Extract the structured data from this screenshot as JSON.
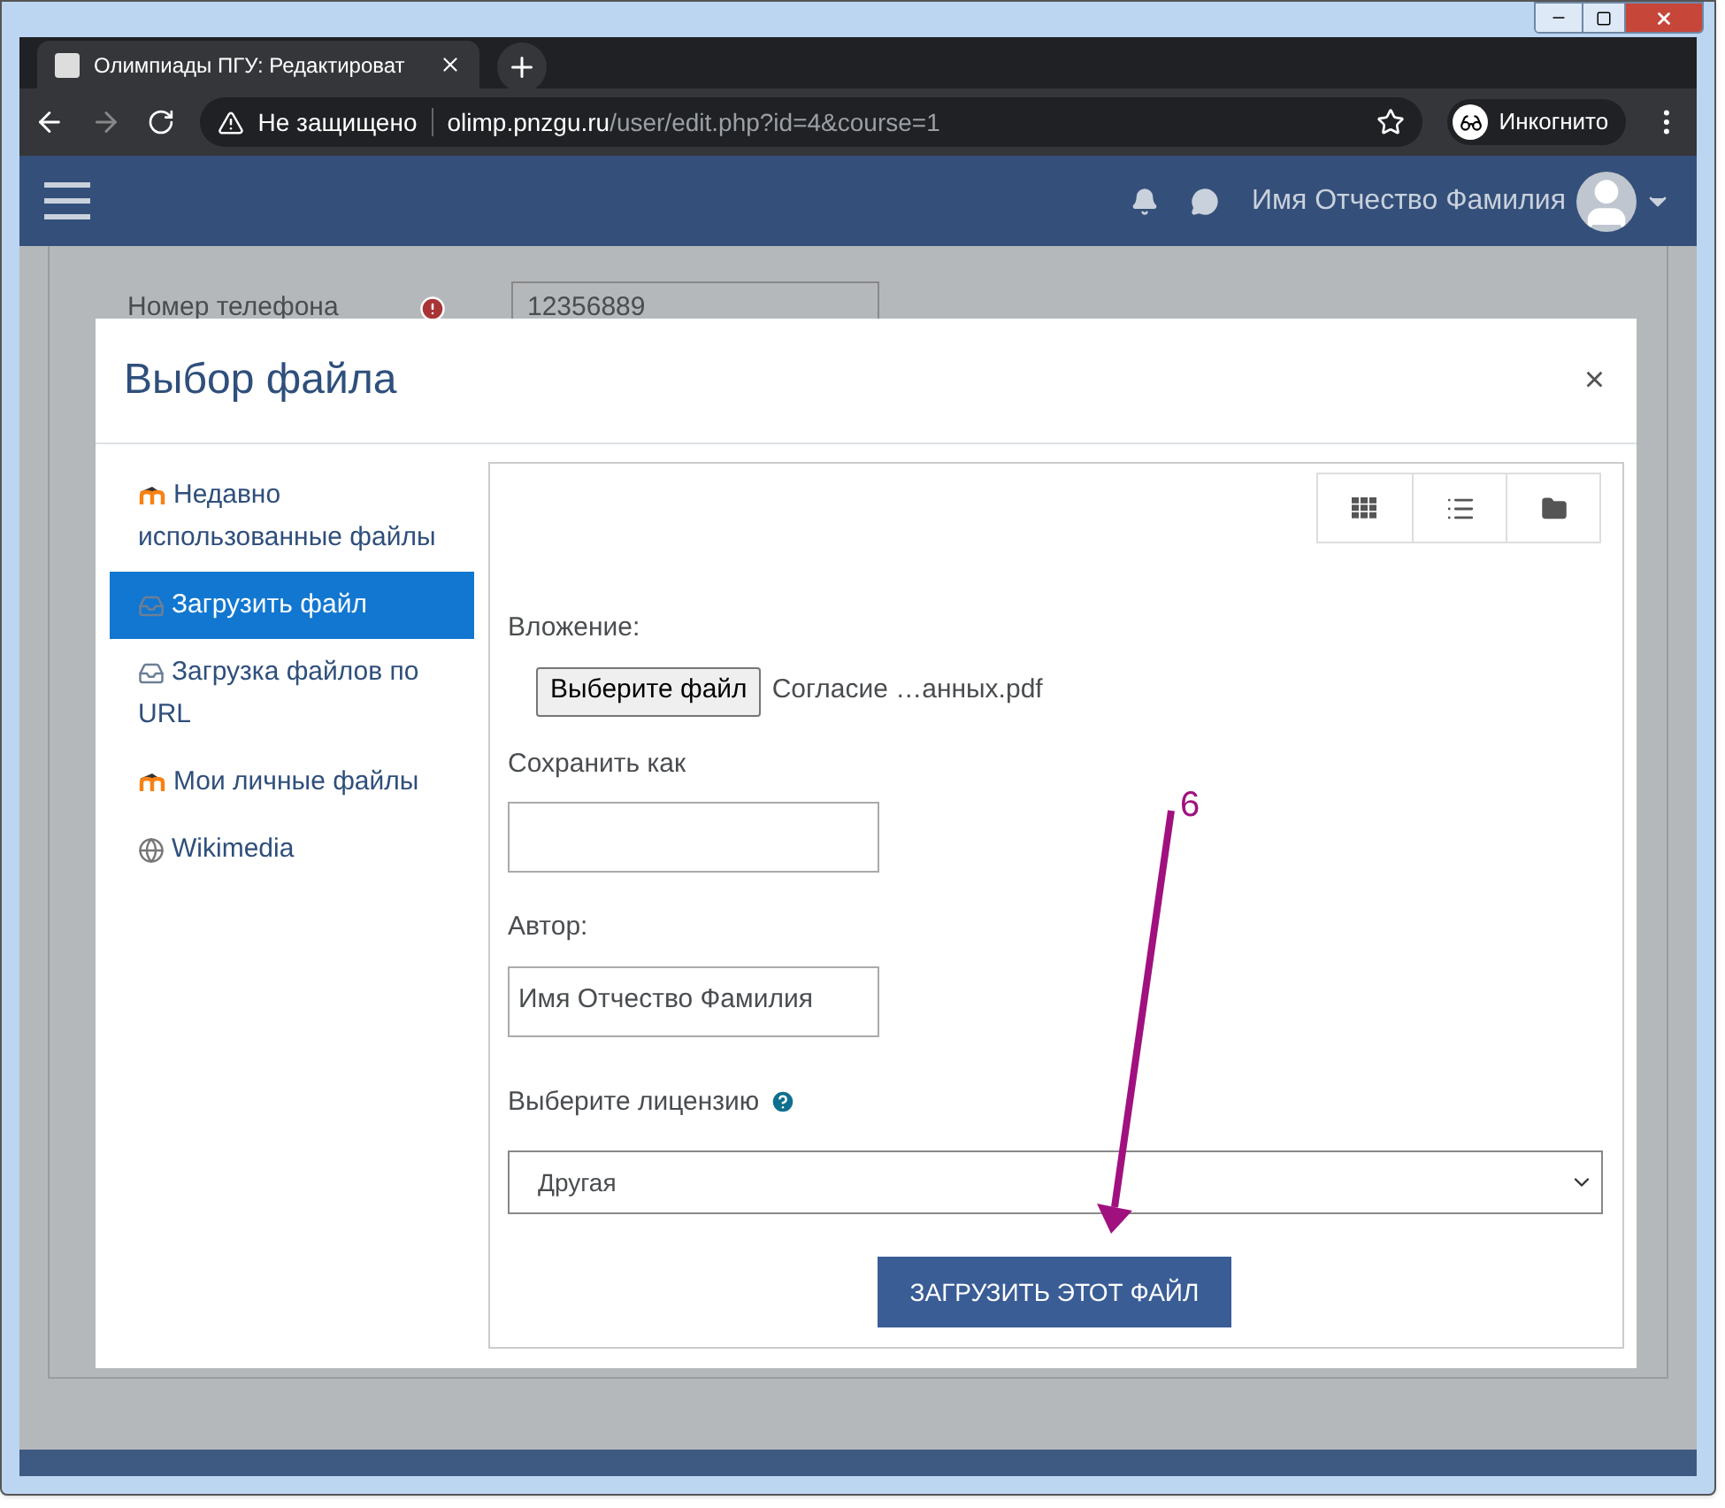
{
  "browser": {
    "tab_title": "Олимпиады ПГУ: Редактироват",
    "security": "Не защищено",
    "url_host": "olimp.pnzgu.ru",
    "url_path": "/user/edit.php?id=4&course=1",
    "incognito": "Инкогнито"
  },
  "navbar": {
    "user_name": "Имя Отчество Фамилия"
  },
  "page": {
    "phone_label": "Номер телефона",
    "phone_value": "12356889"
  },
  "dialog": {
    "title": "Выбор файла",
    "close": "×",
    "repositories": [
      {
        "kind": "moodle",
        "label": "Недавно использованные файлы",
        "selected": false
      },
      {
        "kind": "upload",
        "label": "Загрузить файл",
        "selected": true
      },
      {
        "kind": "upload",
        "label": "Загрузка файлов по URL",
        "selected": false
      },
      {
        "kind": "moodle",
        "label": "Мои личные файлы",
        "selected": false
      },
      {
        "kind": "wiki",
        "label": "Wikimedia",
        "selected": false
      }
    ],
    "view_buttons": [
      {
        "kind": "icons"
      },
      {
        "kind": "list"
      },
      {
        "kind": "tree"
      }
    ],
    "form": {
      "attachment_label": "Вложение:",
      "choose_button": "Выберите файл",
      "chosen_file": "Согласие …анных.pdf",
      "save_as_label": "Сохранить как",
      "author_label": "Автор:",
      "author_value": "Имя Отчество Фамилия",
      "license_label": "Выберите лицензию",
      "license_value": "Другая",
      "upload_button": "ЗАГРУЗИТЬ ЭТОТ ФАЙЛ"
    }
  },
  "annotation": {
    "label": "6"
  }
}
